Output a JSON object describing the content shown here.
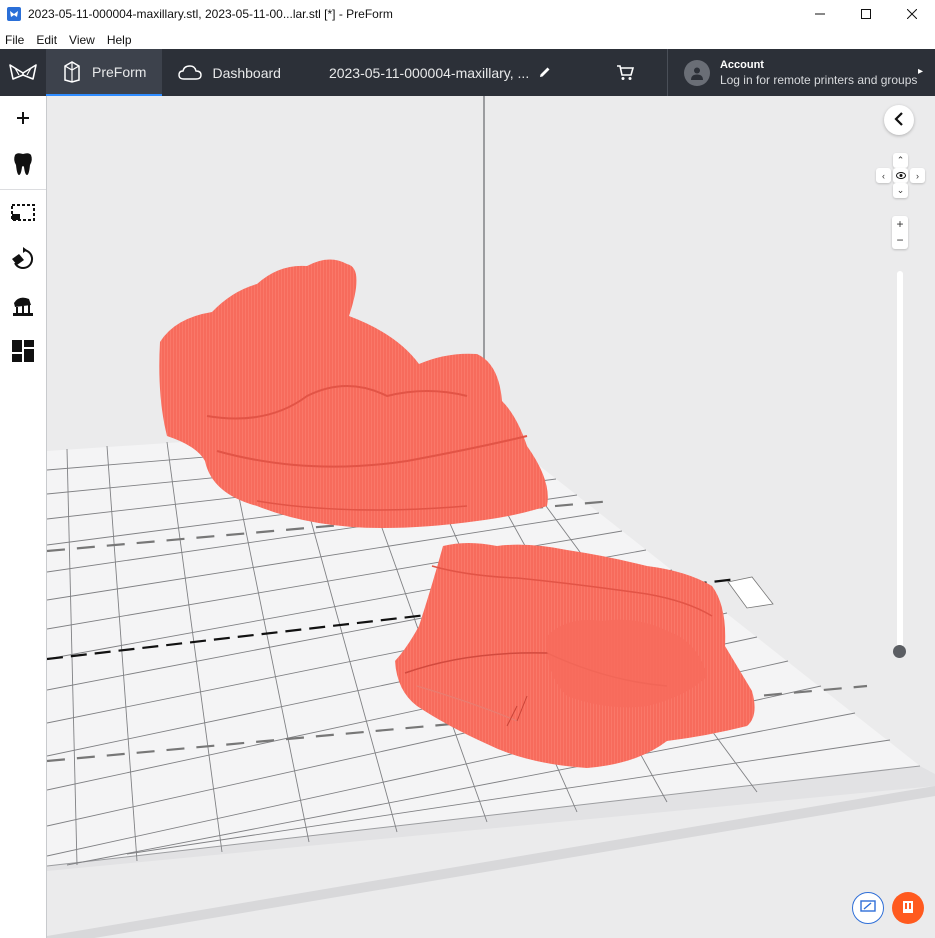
{
  "window": {
    "title": "2023-05-11-000004-maxillary.stl, 2023-05-11-00...lar.stl [*] - PreForm"
  },
  "menu": [
    "File",
    "Edit",
    "View",
    "Help"
  ],
  "header": {
    "tabs": [
      {
        "label": "PreForm",
        "icon": "printer-box-icon",
        "active": true
      },
      {
        "label": "Dashboard",
        "icon": "cloud-icon",
        "active": false
      }
    ],
    "filename": "2023-05-11-000004-maxillary, ...",
    "account": {
      "title": "Account",
      "subtitle": "Log in for remote printers and groups"
    }
  },
  "toolbar": [
    {
      "name": "add-icon"
    },
    {
      "name": "tooth-icon"
    },
    {
      "name": "select-region-icon"
    },
    {
      "name": "orient-icon"
    },
    {
      "name": "supports-icon"
    },
    {
      "name": "layout-icon"
    }
  ],
  "colors": {
    "header_bg": "#2c3038",
    "accent": "#2f8cff",
    "model": "#f76b5c",
    "viewport_bg": "#ebebec",
    "help_button": "#ff5a1f"
  }
}
